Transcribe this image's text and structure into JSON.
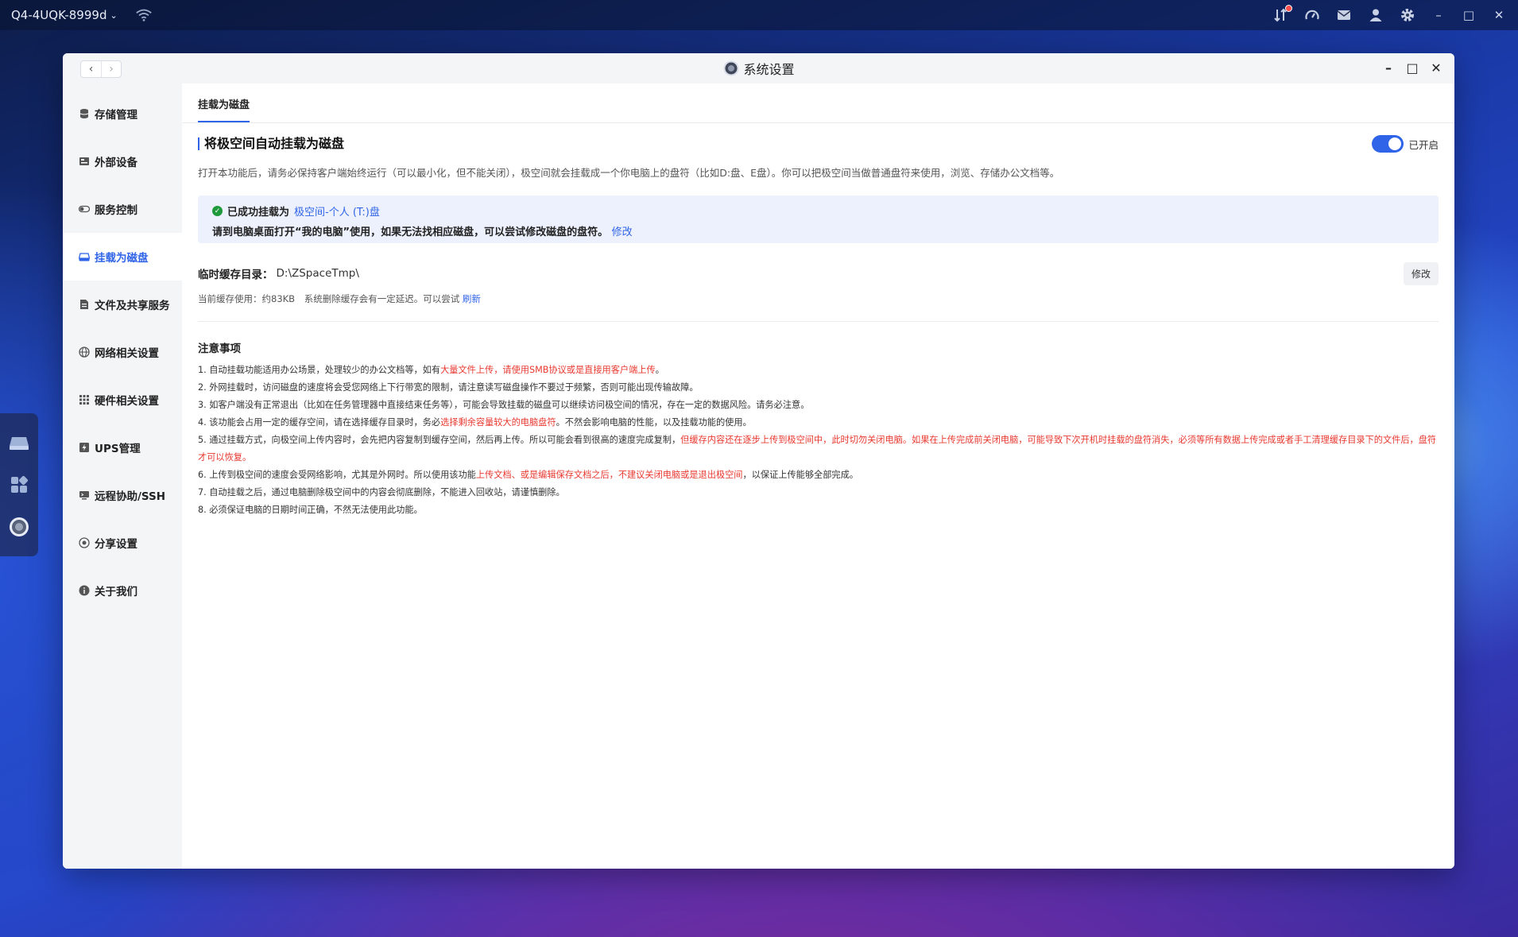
{
  "topbar": {
    "device_name": "Q4-4UQK-8999d",
    "device_chevron": "⌄",
    "tray_icons": [
      "transfer-icon",
      "speedometer-icon",
      "mail-icon",
      "user-icon",
      "gear-icon"
    ],
    "window_controls": [
      "–",
      "□",
      "✕"
    ]
  },
  "window": {
    "title": "系统设置",
    "nav_back": "‹",
    "nav_forward": "›",
    "controls": {
      "minimize": "–",
      "maximize": "□",
      "close": "✕"
    }
  },
  "sidebar": {
    "items": [
      {
        "label": "存储管理",
        "icon": "storage-icon"
      },
      {
        "label": "外部设备",
        "icon": "device-icon"
      },
      {
        "label": "服务控制",
        "icon": "toggle-icon"
      },
      {
        "label": "挂载为磁盘",
        "icon": "disk-icon",
        "active": true
      },
      {
        "label": "文件及共享服务",
        "icon": "file-icon"
      },
      {
        "label": "网络相关设置",
        "icon": "network-icon"
      },
      {
        "label": "硬件相关设置",
        "icon": "hardware-icon"
      },
      {
        "label": "UPS管理",
        "icon": "ups-icon"
      },
      {
        "label": "远程协助/SSH",
        "icon": "remote-icon"
      },
      {
        "label": "分享设置",
        "icon": "share-icon"
      },
      {
        "label": "关于我们",
        "icon": "info-icon"
      }
    ]
  },
  "main": {
    "tab": "挂载为磁盘",
    "section_title": "将极空间自动挂载为磁盘",
    "toggle_label": "已开启",
    "toggle_on": true,
    "description": "打开本功能后，请务必保持客户端始终运行（可以最小化，但不能关闭），极空间就会挂载成一个你电脑上的盘符（比如D:盘、E盘）。你可以把极空间当做普通盘符来使用，浏览、存储办公文档等。",
    "success": {
      "prefix": "已成功挂载为",
      "drive": "极空间-个人 (T:)盘",
      "hint": "请到电脑桌面打开“我的电脑”使用，如果无法找相应磁盘，可以尝试修改磁盘的盘符。",
      "modify_link": "修改"
    },
    "cache": {
      "label": "临时缓存目录：",
      "path": "D:\\ZSpaceTmp\\",
      "modify_button": "修改",
      "usage_prefix": "当前缓存使用：",
      "usage_value": "约83KB",
      "usage_note": "系统删除缓存会有一定延迟。可以尝试",
      "refresh_link": "刷新"
    },
    "notes_title": "注意事项",
    "notes": [
      {
        "a": "1. 自动挂载功能适用办公场景，处理较少的办公文档等，如有",
        "red": "大量文件上传，请使用SMB协议或是直接用客户端上传",
        "b": "。",
        "red2": "",
        "c": ""
      },
      {
        "a": "2. 外网挂载时，访问磁盘的速度将会受您网络上下行带宽的限制，请注意读写磁盘操作不要过于频繁，否则可能出现传输故障。",
        "red": "",
        "b": "",
        "red2": "",
        "c": ""
      },
      {
        "a": "3. 如客户端没有正常退出（比如在任务管理器中直接结束任务等），可能会导致挂载的磁盘可以继续访问极空间的情况，存在一定的数据风险。请务必注意。",
        "red": "",
        "b": "",
        "red2": "",
        "c": ""
      },
      {
        "a": "4. 该功能会占用一定的缓存空间，请在选择缓存目录时，务必",
        "red": "选择剩余容量较大的电脑盘符",
        "b": "。不然会影响电脑的性能，以及挂载功能的使用。",
        "red2": "",
        "c": ""
      },
      {
        "a": "5. 通过挂载方式，向极空间上传内容时，会先把内容复制到缓存空间，然后再上传。所以可能会看到很高的速度完成复制，",
        "red": "但缓存内容还在逐步上传到极空间中，此时切勿关闭电脑。如果在上传完成前关闭电脑，可能导致下次开机时挂载的盘符消失，必须等所有数据上传完成或者手工清理缓存目录下的文件后，盘符才可以恢复。",
        "b": "",
        "red2": "",
        "c": ""
      },
      {
        "a": "6. 上传到极空间的速度会受网络影响，尤其是外网时。所以使用该功能",
        "red": "上传文档、或是编辑保存文档之后，不建议关闭电脑或是退出极空间",
        "b": "，以保证上传能够全部完成。",
        "red2": "",
        "c": ""
      },
      {
        "a": "7. 自动挂载之后，通过电脑删除极空间中的内容会彻底删除，不能进入回收站，请谨慎删除。",
        "red": "",
        "b": "",
        "red2": "",
        "c": ""
      },
      {
        "a": "8. 必须保证电脑的日期时间正确，不然无法使用此功能。",
        "red": "",
        "b": "",
        "red2": "",
        "c": ""
      }
    ]
  },
  "colors": {
    "accent": "#2f64e8",
    "warning_red": "#e8382f",
    "success_green": "#1e9a3c"
  }
}
